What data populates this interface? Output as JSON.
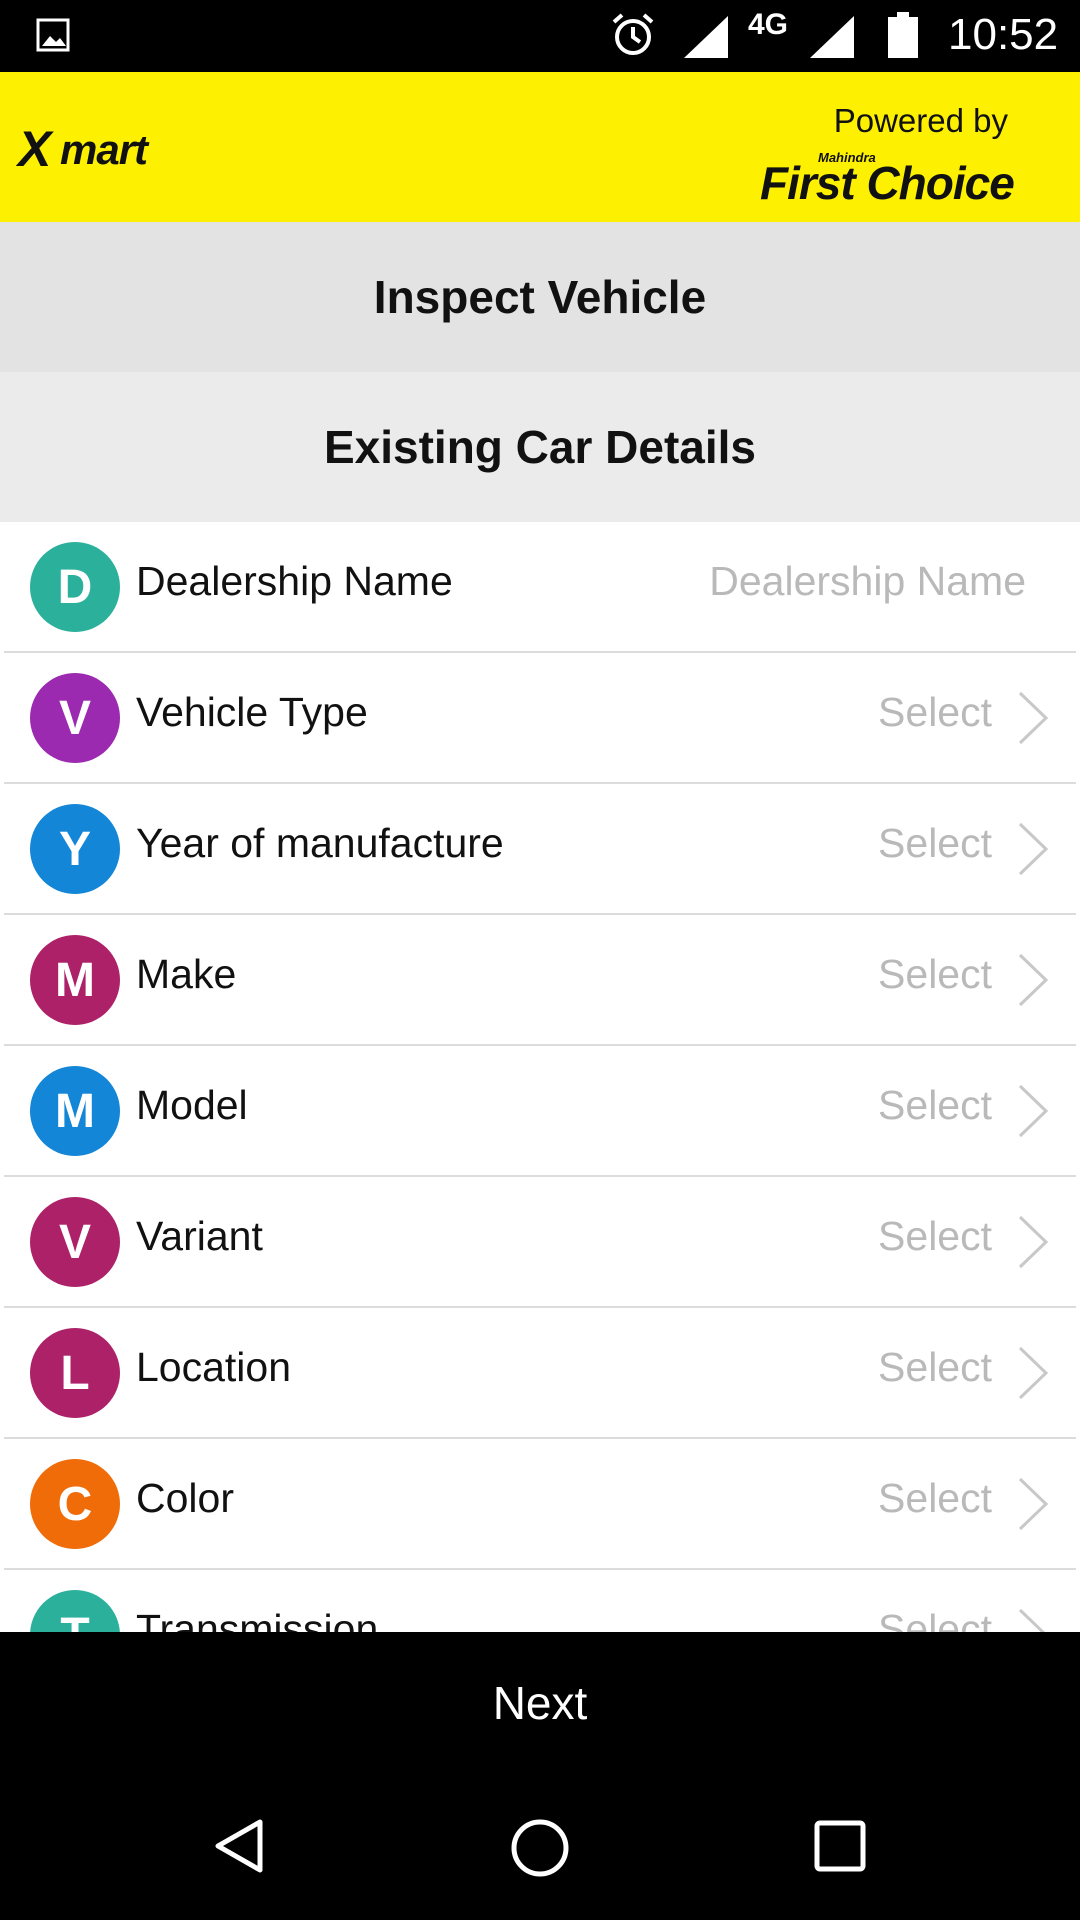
{
  "status_bar": {
    "network": "4G",
    "time": "10:52",
    "icons": [
      "gallery-icon",
      "alarm-icon",
      "signal-icon",
      "signal-icon",
      "battery-icon"
    ]
  },
  "header": {
    "logo_text": "X-mart",
    "powered_by": "Powered by",
    "partner_small": "Mahindra",
    "partner_name": "First Choice",
    "background_color": "#fdf000"
  },
  "page": {
    "title": "Inspect Vehicle",
    "section_title": "Existing Car Details"
  },
  "form": {
    "rows": [
      {
        "initial": "D",
        "label": "Dealership Name",
        "value": "Dealership Name",
        "color": "#2bb19b",
        "kind": "input"
      },
      {
        "initial": "V",
        "label": "Vehicle Type",
        "value": "Select",
        "color": "#9c2ab0",
        "kind": "select"
      },
      {
        "initial": "Y",
        "label": "Year of manufacture",
        "value": "Select",
        "color": "#1486d7",
        "kind": "select"
      },
      {
        "initial": "M",
        "label": "Make",
        "value": "Select",
        "color": "#ad2169",
        "kind": "select"
      },
      {
        "initial": "M",
        "label": "Model",
        "value": "Select",
        "color": "#1486d7",
        "kind": "select"
      },
      {
        "initial": "V",
        "label": "Variant",
        "value": "Select",
        "color": "#ad2169",
        "kind": "select"
      },
      {
        "initial": "L",
        "label": "Location",
        "value": "Select",
        "color": "#ad2169",
        "kind": "select"
      },
      {
        "initial": "C",
        "label": "Color",
        "value": "Select",
        "color": "#ef6c08",
        "kind": "select"
      },
      {
        "initial": "T",
        "label": "Transmission",
        "value": "Select",
        "color": "#2bb19b",
        "kind": "select"
      }
    ]
  },
  "footer": {
    "next_label": "Next"
  }
}
